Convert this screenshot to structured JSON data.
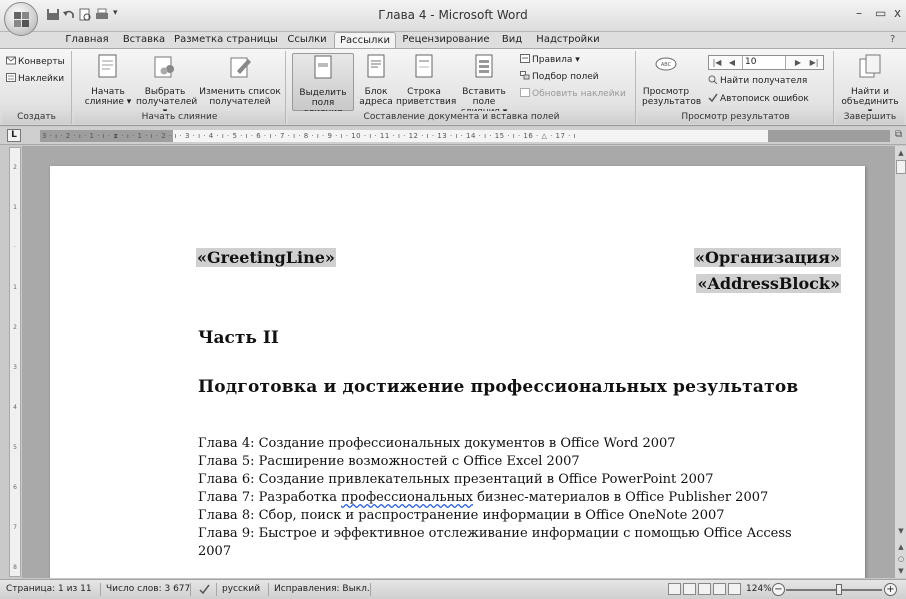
{
  "window": {
    "title": "Глава 4 - Microsoft Word",
    "minimize": "–",
    "restore": "▭",
    "close": "x"
  },
  "tabs": [
    "Главная",
    "Вставка",
    "Разметка страницы",
    "Ссылки",
    "Рассылки",
    "Рецензирование",
    "Вид",
    "Надстройки"
  ],
  "active_tab": "Рассылки",
  "ribbon": {
    "create": {
      "label": "Создать",
      "envelopes": "Конверты",
      "labels": "Наклейки"
    },
    "start_merge": {
      "label": "Начать слияние",
      "start": "Начать\nслияние ▾",
      "select": "Выбрать\nполучателей ▾",
      "edit": "Изменить список\nполучателей"
    },
    "write_insert": {
      "label": "Составление документа и вставка полей",
      "highlight": "Выделить\nполя слияния",
      "address": "Блок\nадреса",
      "greeting": "Строка\nприветствия",
      "insert_field": "Вставить поле\nслияния ▾",
      "rules": "Правила ▾",
      "match": "Подбор полей",
      "update": "Обновить наклейки"
    },
    "preview": {
      "label": "Просмотр результатов",
      "preview_btn": "Просмотр\nрезультатов",
      "record": "10",
      "find": "Найти получателя",
      "auto_check": "Автопоиск ошибок"
    },
    "finish": {
      "label": "Завершить",
      "finish_btn": "Найти и\nобъединить ▾"
    }
  },
  "ruler": {
    "tab_selector": "L",
    "marks": "3 · ı · 2 · ı · 1 · ı · ⧗ · ı · 1 · ı · 2 · ı · 3 · ı · 4 · ı · 5 · ı · 6 · ı · 7 · ı · 8 · ı · 9 · ı · 10 · ı · 11 · ı · 12 · ı · 13 · ı · 14 · ı · 15 · ı · 16 · △ · 17 · ı"
  },
  "vruler_marks": [
    "2",
    "1",
    "·",
    "1",
    "2",
    "3",
    "4",
    "5",
    "6",
    "7",
    "8"
  ],
  "document": {
    "greeting_field": "«GreetingLine»",
    "org_field": "«Организация»",
    "address_field": "«AddressBlock»",
    "part": "Часть II",
    "section": "Подготовка и достижение профессиональных результатов",
    "chapters": [
      "Глава 4: Создание профессиональных документов в Office Word 2007",
      "Глава 5: Расширение возможностей с Office Excel 2007",
      "Глава 6: Создание привлекательных презентаций в Office PowerPoint 2007",
      "Глава 7: Разработка ",
      "Глава 8: Сбор, поиск и распространение информации в Office OneNote 2007",
      "Глава 9: Быстрое и эффективное отслеживание информации с помощью Office Access",
      "2007"
    ],
    "ch7_underlined": "профессиональных",
    "ch7_rest": " бизнес-материалов в Office Publisher 2007"
  },
  "status": {
    "page": "Страница: 1 из 11",
    "words": "Число слов: 3 677",
    "language": "русский",
    "track": "Исправления: Выкл.",
    "zoom": "124%",
    "zoom_out": "−",
    "zoom_in": "+"
  }
}
